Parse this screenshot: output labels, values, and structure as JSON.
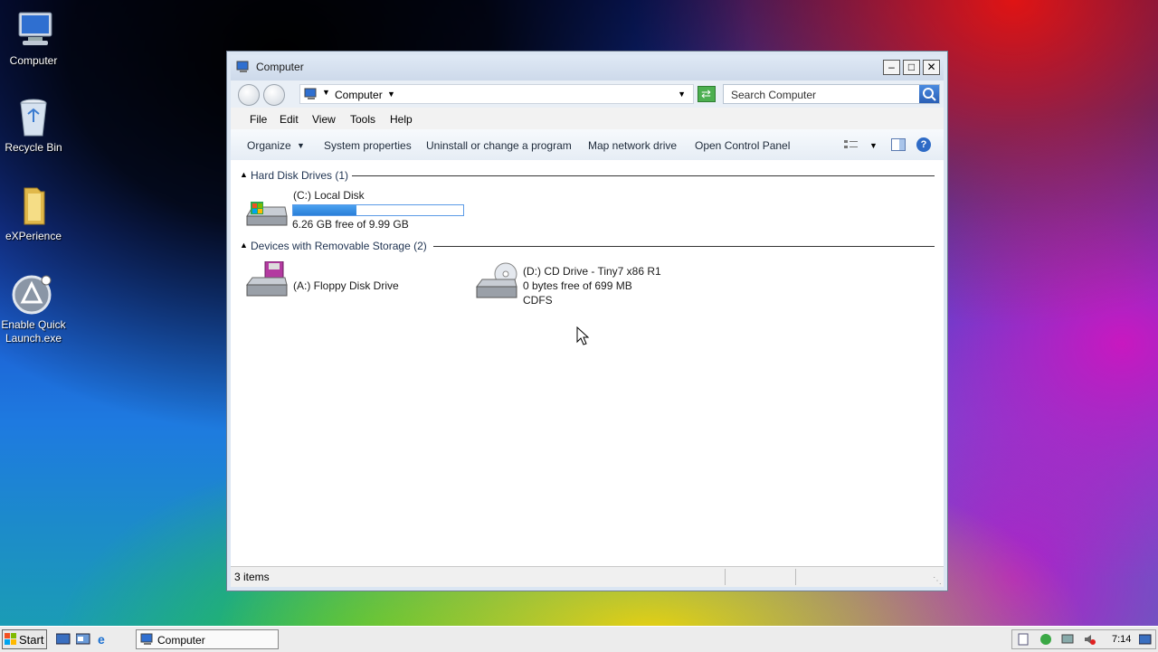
{
  "desktop": {
    "icons": [
      {
        "label": "Computer",
        "icon": "computer-icon"
      },
      {
        "label": "Recycle Bin",
        "icon": "recycle-bin-icon"
      },
      {
        "label": "eXPerience",
        "icon": "folder-icon"
      },
      {
        "label": "Enable Quick Launch.exe",
        "icon": "launcher-icon"
      }
    ]
  },
  "window": {
    "title": "Computer",
    "address": {
      "location": "Computer"
    },
    "search": {
      "placeholder": "Search Computer"
    },
    "menu": [
      "File",
      "Edit",
      "View",
      "Tools",
      "Help"
    ],
    "commands": [
      "Organize",
      "System properties",
      "Uninstall or change a program",
      "Map network drive",
      "Open Control Panel"
    ],
    "groups": [
      {
        "title": "Hard Disk Drives (1)",
        "drives": [
          {
            "name": "(C:) Local Disk",
            "free_text": "6.26 GB free of 9.99 GB",
            "used_fraction": 0.37,
            "icon": "hard-disk-icon"
          }
        ]
      },
      {
        "title": "Devices with Removable Storage (2)",
        "drives": [
          {
            "name": "(A:) Floppy Disk Drive",
            "icon": "floppy-drive-icon"
          },
          {
            "name": "(D:) CD Drive - Tiny7 x86 R1",
            "free_text": "0 bytes free of 699 MB",
            "filesystem": "CDFS",
            "icon": "cd-drive-icon"
          }
        ]
      }
    ],
    "status": {
      "items": "3 items"
    }
  },
  "taskbar": {
    "start_label": "Start",
    "task_label": "Computer",
    "clock": "7:14"
  },
  "colors": {
    "accent": "#3a8ee6",
    "window_frame": "#dbe6f3"
  }
}
